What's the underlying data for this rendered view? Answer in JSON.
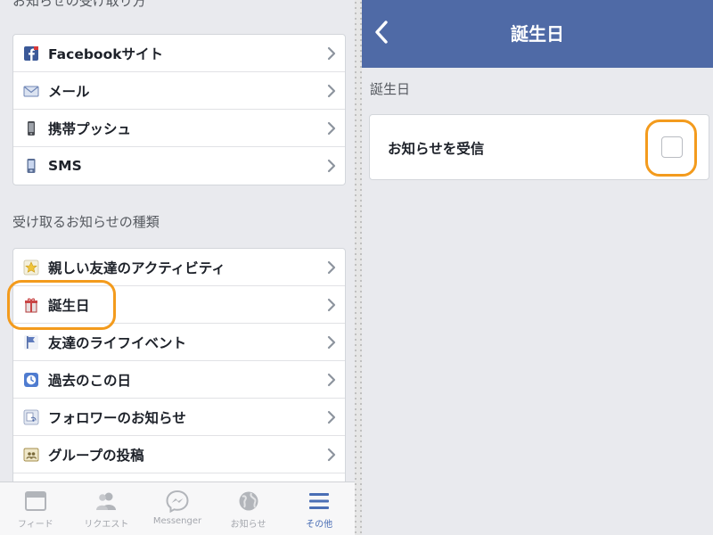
{
  "left": {
    "section_partial": "お知らせの受け取り方",
    "delivery_items": [
      {
        "label": "Facebookサイト",
        "icon": "facebook-icon"
      },
      {
        "label": "メール",
        "icon": "mail-icon"
      },
      {
        "label": "携帯プッシュ",
        "icon": "phone-icon"
      },
      {
        "label": "SMS",
        "icon": "sms-phone-icon"
      }
    ],
    "types_header": "受け取るお知らせの種類",
    "type_items": [
      {
        "label": "親しい友達のアクティビティ",
        "icon": "star-icon"
      },
      {
        "label": "誕生日",
        "icon": "gift-icon"
      },
      {
        "label": "友達のライフイベント",
        "icon": "flag-icon"
      },
      {
        "label": "過去のこの日",
        "icon": "clock-icon"
      },
      {
        "label": "フォロワーのお知らせ",
        "icon": "rss-icon"
      },
      {
        "label": "グループの投稿",
        "icon": "group-icon"
      }
    ],
    "tabs": [
      {
        "label": "フィード",
        "icon": "feed-icon",
        "active": false
      },
      {
        "label": "リクエスト",
        "icon": "friends-icon",
        "active": false
      },
      {
        "label": "Messenger",
        "icon": "messenger-icon",
        "active": false
      },
      {
        "label": "お知らせ",
        "icon": "globe-icon",
        "active": false
      },
      {
        "label": "その他",
        "icon": "menu-icon",
        "active": true
      }
    ]
  },
  "right": {
    "nav_title": "誕生日",
    "section_header": "誕生日",
    "setting_label": "お知らせを受信",
    "checkbox_checked": false
  },
  "colors": {
    "nav_bar": "#4f6aa6",
    "highlight": "#f39b1d",
    "background": "#e9eaee",
    "active_tab": "#4a6eb5"
  }
}
